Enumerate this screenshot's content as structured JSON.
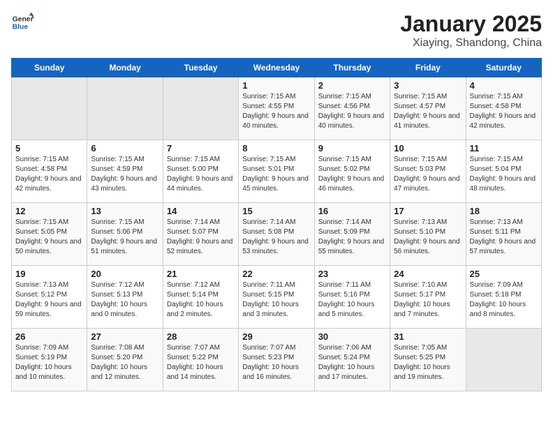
{
  "logo": {
    "line1": "General",
    "line2": "Blue"
  },
  "title": "January 2025",
  "subtitle": "Xiaying, Shandong, China",
  "days_of_week": [
    "Sunday",
    "Monday",
    "Tuesday",
    "Wednesday",
    "Thursday",
    "Friday",
    "Saturday"
  ],
  "weeks": [
    [
      {
        "day": "",
        "empty": true
      },
      {
        "day": "",
        "empty": true
      },
      {
        "day": "",
        "empty": true
      },
      {
        "day": "1",
        "sunrise": "7:15 AM",
        "sunset": "4:55 PM",
        "daylight": "9 hours and 40 minutes."
      },
      {
        "day": "2",
        "sunrise": "7:15 AM",
        "sunset": "4:56 PM",
        "daylight": "9 hours and 40 minutes."
      },
      {
        "day": "3",
        "sunrise": "7:15 AM",
        "sunset": "4:57 PM",
        "daylight": "9 hours and 41 minutes."
      },
      {
        "day": "4",
        "sunrise": "7:15 AM",
        "sunset": "4:58 PM",
        "daylight": "9 hours and 42 minutes."
      }
    ],
    [
      {
        "day": "5",
        "sunrise": "7:15 AM",
        "sunset": "4:58 PM",
        "daylight": "9 hours and 42 minutes."
      },
      {
        "day": "6",
        "sunrise": "7:15 AM",
        "sunset": "4:59 PM",
        "daylight": "9 hours and 43 minutes."
      },
      {
        "day": "7",
        "sunrise": "7:15 AM",
        "sunset": "5:00 PM",
        "daylight": "9 hours and 44 minutes."
      },
      {
        "day": "8",
        "sunrise": "7:15 AM",
        "sunset": "5:01 PM",
        "daylight": "9 hours and 45 minutes."
      },
      {
        "day": "9",
        "sunrise": "7:15 AM",
        "sunset": "5:02 PM",
        "daylight": "9 hours and 46 minutes."
      },
      {
        "day": "10",
        "sunrise": "7:15 AM",
        "sunset": "5:03 PM",
        "daylight": "9 hours and 47 minutes."
      },
      {
        "day": "11",
        "sunrise": "7:15 AM",
        "sunset": "5:04 PM",
        "daylight": "9 hours and 48 minutes."
      }
    ],
    [
      {
        "day": "12",
        "sunrise": "7:15 AM",
        "sunset": "5:05 PM",
        "daylight": "9 hours and 50 minutes."
      },
      {
        "day": "13",
        "sunrise": "7:15 AM",
        "sunset": "5:06 PM",
        "daylight": "9 hours and 51 minutes."
      },
      {
        "day": "14",
        "sunrise": "7:14 AM",
        "sunset": "5:07 PM",
        "daylight": "9 hours and 52 minutes."
      },
      {
        "day": "15",
        "sunrise": "7:14 AM",
        "sunset": "5:08 PM",
        "daylight": "9 hours and 53 minutes."
      },
      {
        "day": "16",
        "sunrise": "7:14 AM",
        "sunset": "5:09 PM",
        "daylight": "9 hours and 55 minutes."
      },
      {
        "day": "17",
        "sunrise": "7:13 AM",
        "sunset": "5:10 PM",
        "daylight": "9 hours and 56 minutes."
      },
      {
        "day": "18",
        "sunrise": "7:13 AM",
        "sunset": "5:11 PM",
        "daylight": "9 hours and 57 minutes."
      }
    ],
    [
      {
        "day": "19",
        "sunrise": "7:13 AM",
        "sunset": "5:12 PM",
        "daylight": "9 hours and 59 minutes."
      },
      {
        "day": "20",
        "sunrise": "7:12 AM",
        "sunset": "5:13 PM",
        "daylight": "10 hours and 0 minutes."
      },
      {
        "day": "21",
        "sunrise": "7:12 AM",
        "sunset": "5:14 PM",
        "daylight": "10 hours and 2 minutes."
      },
      {
        "day": "22",
        "sunrise": "7:11 AM",
        "sunset": "5:15 PM",
        "daylight": "10 hours and 3 minutes."
      },
      {
        "day": "23",
        "sunrise": "7:11 AM",
        "sunset": "5:16 PM",
        "daylight": "10 hours and 5 minutes."
      },
      {
        "day": "24",
        "sunrise": "7:10 AM",
        "sunset": "5:17 PM",
        "daylight": "10 hours and 7 minutes."
      },
      {
        "day": "25",
        "sunrise": "7:09 AM",
        "sunset": "5:18 PM",
        "daylight": "10 hours and 8 minutes."
      }
    ],
    [
      {
        "day": "26",
        "sunrise": "7:09 AM",
        "sunset": "5:19 PM",
        "daylight": "10 hours and 10 minutes."
      },
      {
        "day": "27",
        "sunrise": "7:08 AM",
        "sunset": "5:20 PM",
        "daylight": "10 hours and 12 minutes."
      },
      {
        "day": "28",
        "sunrise": "7:07 AM",
        "sunset": "5:22 PM",
        "daylight": "10 hours and 14 minutes."
      },
      {
        "day": "29",
        "sunrise": "7:07 AM",
        "sunset": "5:23 PM",
        "daylight": "10 hours and 16 minutes."
      },
      {
        "day": "30",
        "sunrise": "7:06 AM",
        "sunset": "5:24 PM",
        "daylight": "10 hours and 17 minutes."
      },
      {
        "day": "31",
        "sunrise": "7:05 AM",
        "sunset": "5:25 PM",
        "daylight": "10 hours and 19 minutes."
      },
      {
        "day": "",
        "empty": true
      }
    ]
  ],
  "labels": {
    "sunrise": "Sunrise:",
    "sunset": "Sunset:",
    "daylight": "Daylight:"
  }
}
